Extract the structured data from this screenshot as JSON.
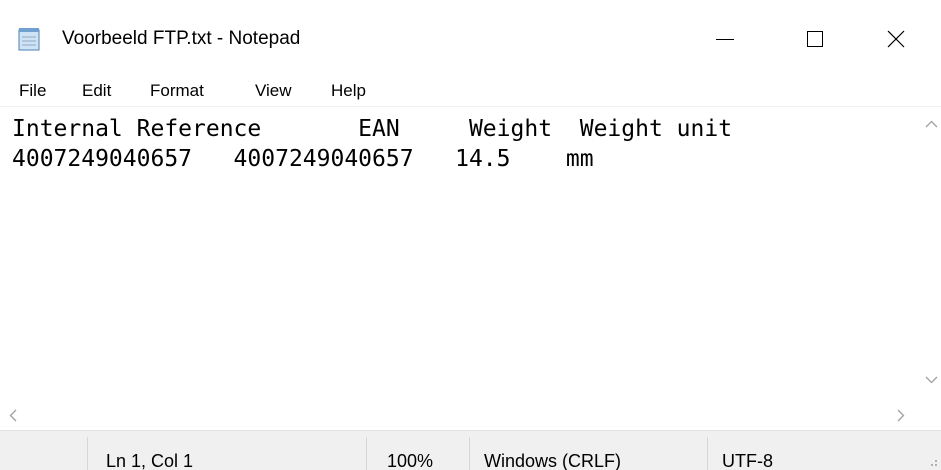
{
  "window": {
    "title": "Voorbeeld FTP.txt - Notepad",
    "icon": "notepad-icon",
    "controls": [
      "minimize-icon",
      "maximize-icon",
      "close-icon"
    ]
  },
  "menu": {
    "file": "File",
    "edit": "Edit",
    "format": "Format",
    "view": "View",
    "help": "Help"
  },
  "content": {
    "lines": [
      "Internal Reference       EAN     Weight  Weight unit",
      "4007249040657   4007249040657   14.5    mm"
    ]
  },
  "scrollbars": {
    "vertical": [
      "chevron-up-icon",
      "chevron-down-icon"
    ],
    "horizontal": [
      "chevron-left-icon",
      "chevron-right-icon"
    ]
  },
  "status": {
    "position": "Ln 1, Col 1",
    "zoom": "100%",
    "line_ending": "Windows (CRLF)",
    "encoding": "UTF-8"
  },
  "colors": {
    "background": "#ffffff",
    "statusbar": "#f0f0f0",
    "scroll_arrow": "#a0a0a0"
  }
}
